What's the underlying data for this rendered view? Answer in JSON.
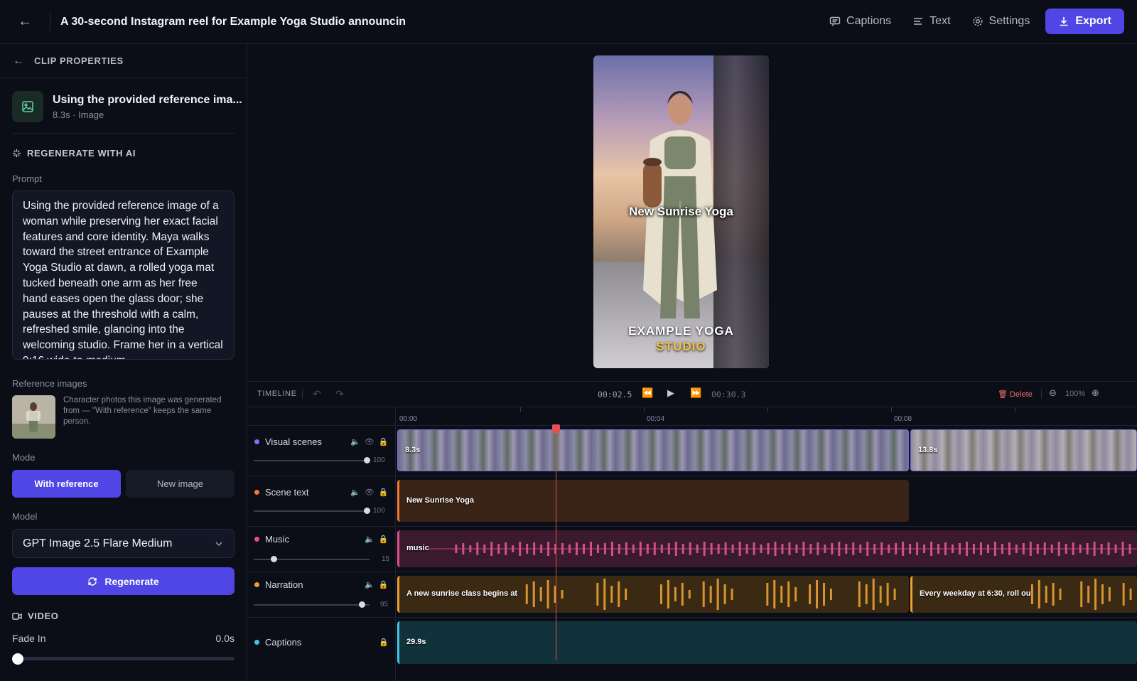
{
  "header": {
    "title": "A 30-second Instagram reel for Example Yoga Studio announcin",
    "captions_label": "Captions",
    "text_label": "Text",
    "settings_label": "Settings",
    "export_label": "Export"
  },
  "left_panel": {
    "heading": "CLIP PROPERTIES",
    "clip": {
      "name": "Using the provided reference ima...",
      "meta": "8.3s · Image"
    },
    "regenerate_section": "REGENERATE WITH AI",
    "prompt_label": "Prompt",
    "prompt_text": "Using the provided reference image of a woman while preserving her exact facial features and core identity. Maya walks toward the street entrance of Example Yoga Studio at dawn, a rolled yoga mat tucked beneath one arm as her free hand eases open the glass door; she pauses at the threshold with a calm, refreshed smile, glancing into the welcoming studio. Frame her in a vertical 9:16 wide-to-medium",
    "reference_label": "Reference images",
    "reference_desc": "Character photos this image was generated from — \"With reference\" keeps the same person.",
    "mode_label": "Mode",
    "mode_with": "With reference",
    "mode_new": "New image",
    "model_label": "Model",
    "model_value": "GPT Image 2.5 Flare Medium",
    "regenerate_button": "Regenerate",
    "video_section": "VIDEO",
    "fade_in_label": "Fade In",
    "fade_in_value": "0.0s"
  },
  "preview": {
    "overlay_title": "New Sunrise Yoga",
    "overlay_brand_line1": "EXAMPLE YOGA",
    "overlay_brand_line2": "STUDIO"
  },
  "timeline": {
    "label": "TIMELINE",
    "current_time": "00:02.5",
    "total_time": "00:30.3",
    "delete_label": "Delete",
    "zoom": "100%",
    "ruler": [
      "00:00",
      "00:04",
      "00:08"
    ],
    "tracks": [
      {
        "name": "Visual scenes",
        "color": "#8b6cf0",
        "volume": "100"
      },
      {
        "name": "Scene text",
        "color": "#f07a2e",
        "volume": "100"
      },
      {
        "name": "Music",
        "color": "#e0508f",
        "volume": "15"
      },
      {
        "name": "Narration",
        "color": "#f0a030",
        "volume": "95"
      },
      {
        "name": "Captions",
        "color": "#46c4e6"
      }
    ],
    "clips": {
      "visual_1": "8.3s",
      "visual_2": "13.8s",
      "scene_text": "New Sunrise Yoga",
      "music": "music",
      "narration_1": "A new sunrise class begins at",
      "narration_2": "Every weekday at 6:30, roll ou",
      "captions": "29.9s"
    }
  }
}
